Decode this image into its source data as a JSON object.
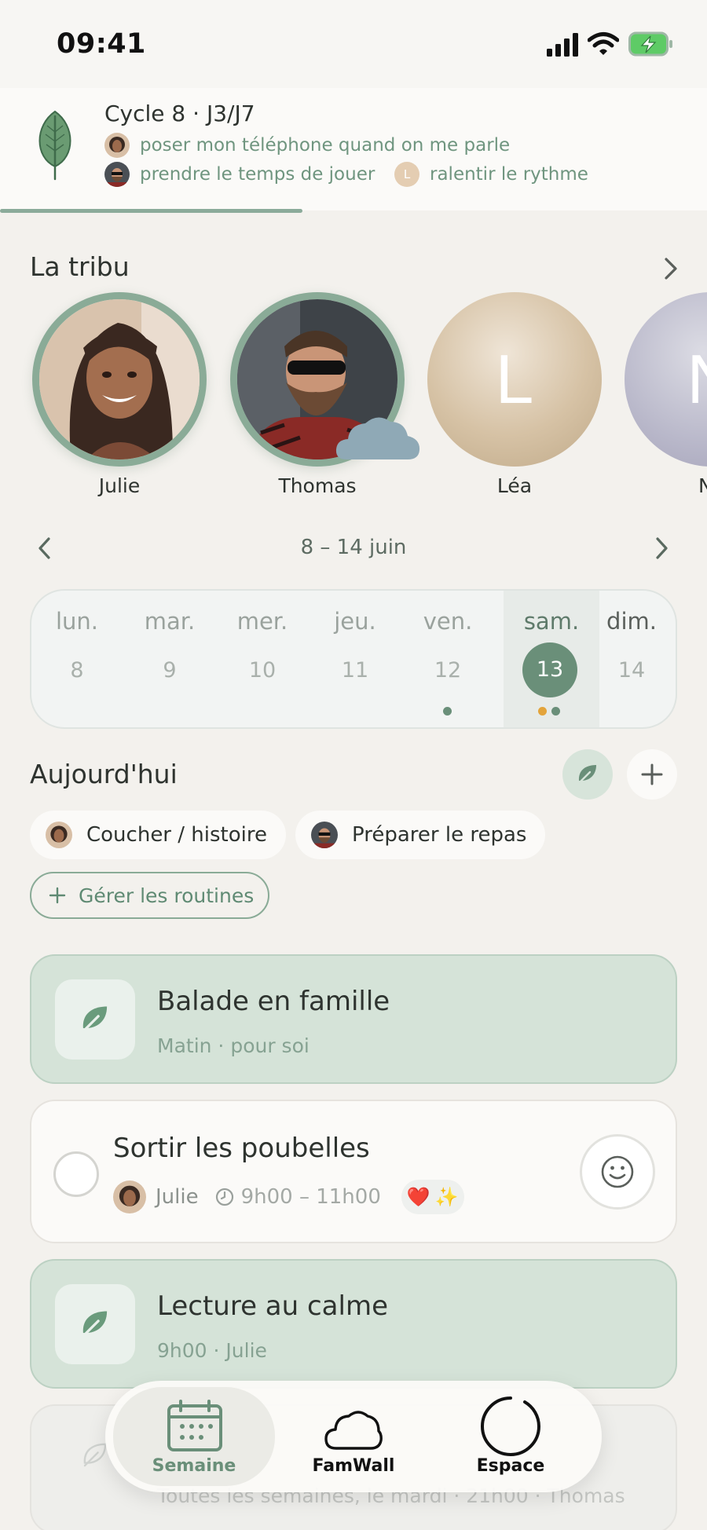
{
  "status_bar": {
    "time": "09:41"
  },
  "cycle": {
    "title": "Cycle 8 · J3/J7",
    "goals": [
      {
        "text": "poser mon téléphone quand on me parle",
        "owner": "Julie"
      },
      {
        "text": "prendre le temps de jouer",
        "owner": "Thomas"
      },
      {
        "text": "ralentir le rythme",
        "owner": "Léa",
        "owner_initial": "L"
      }
    ]
  },
  "tribe": {
    "title": "La tribu",
    "members": [
      {
        "name": "Julie"
      },
      {
        "name": "Thomas"
      },
      {
        "name": "Léa",
        "initial": "L"
      },
      {
        "name": "No",
        "initial": "N"
      }
    ]
  },
  "week": {
    "range": "8 – 14 juin",
    "days": [
      {
        "name": "lun.",
        "num": "8"
      },
      {
        "name": "mar.",
        "num": "9"
      },
      {
        "name": "mer.",
        "num": "10"
      },
      {
        "name": "jeu.",
        "num": "11"
      },
      {
        "name": "ven.",
        "num": "12"
      },
      {
        "name": "sam.",
        "num": "13"
      },
      {
        "name": "dim.",
        "num": "14"
      }
    ],
    "today_index": 5
  },
  "today": {
    "title": "Aujourd'hui",
    "routines": [
      {
        "label": "Coucher / histoire",
        "owner": "Julie"
      },
      {
        "label": "Préparer le repas",
        "owner": "Thomas"
      }
    ],
    "manage_label": "Gérer les routines"
  },
  "activities": [
    {
      "title": "Balade en famille",
      "subtitle": "Matin · pour soi"
    },
    {
      "title": "Lecture au calme",
      "subtitle": "9h00 · Julie"
    }
  ],
  "task": {
    "title": "Sortir les poubelles",
    "assignee": "Julie",
    "time": "9h00 – 11h00",
    "reactions": [
      "❤️",
      "✨"
    ]
  },
  "faded_card": {
    "subtitle": "Toutes les semaines, le mardi · 21h00 · Thomas"
  },
  "tabbar": {
    "tabs": [
      {
        "label": "Semaine"
      },
      {
        "label": "FamWall"
      },
      {
        "label": "Espace"
      }
    ]
  },
  "colors": {
    "accent": "#6a8f79",
    "leaf": "#6a9b72",
    "card_green": "#d5e3d8",
    "background": "#f3f1ed"
  }
}
